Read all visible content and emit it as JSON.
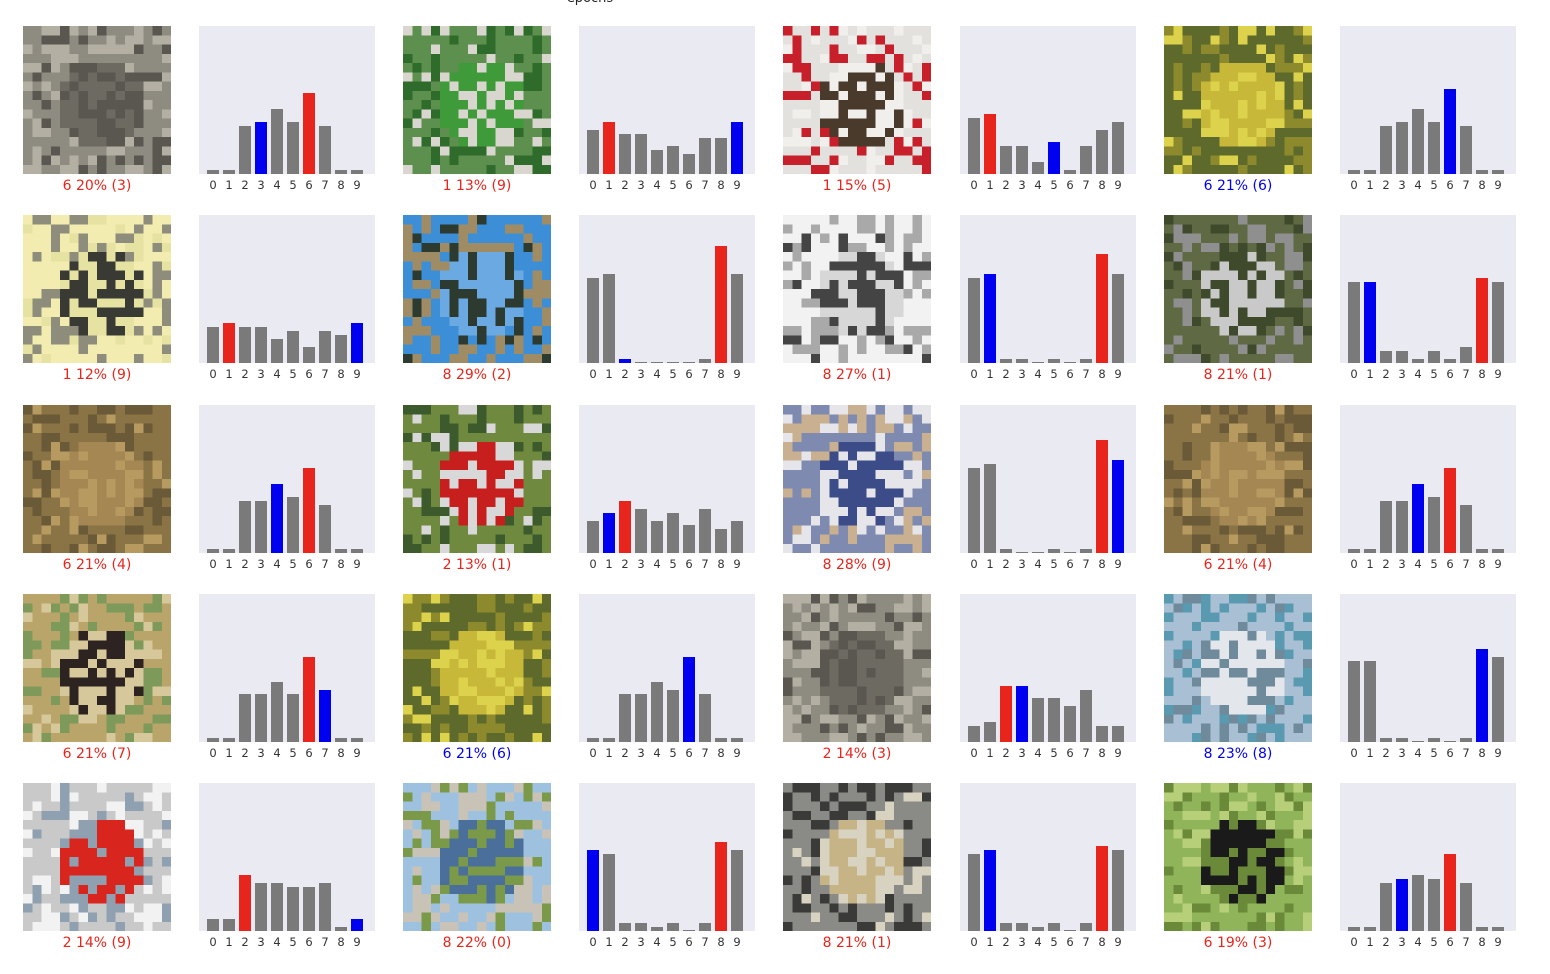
{
  "header_label": "epochs",
  "colors": {
    "predicted_wrong": "#e8251c",
    "true_label": "#0000f0",
    "other": "#7a7a7a",
    "caption_wrong": "#e8251c",
    "caption_right": "#0000f0",
    "bar_bg": "#eaeaf2"
  },
  "tick_labels": [
    "0",
    "1",
    "2",
    "3",
    "4",
    "5",
    "6",
    "7",
    "8",
    "9"
  ],
  "chart_data": {
    "type": "bar",
    "grid": false,
    "ylim": [
      0,
      1
    ],
    "categories": [
      "0",
      "1",
      "2",
      "3",
      "4",
      "5",
      "6",
      "7",
      "8",
      "9"
    ],
    "panels": [
      {
        "image": "cat",
        "caption": "6 20% (3)",
        "predicted": 6,
        "true": 3,
        "values": [
          0.01,
          0.01,
          0.12,
          0.13,
          0.16,
          0.13,
          0.2,
          0.12,
          0.01,
          0.01
        ]
      },
      {
        "image": "green truck",
        "caption": "1 13% (9)",
        "predicted": 1,
        "true": 9,
        "values": [
          0.11,
          0.13,
          0.1,
          0.1,
          0.06,
          0.07,
          0.05,
          0.09,
          0.09,
          0.13
        ]
      },
      {
        "image": "dog with flower",
        "caption": "1 15% (5)",
        "predicted": 1,
        "true": 5,
        "values": [
          0.14,
          0.15,
          0.07,
          0.07,
          0.03,
          0.08,
          0.01,
          0.07,
          0.11,
          0.13
        ]
      },
      {
        "image": "frog",
        "caption": "6 21% (6)",
        "predicted": 6,
        "true": 6,
        "values": [
          0.01,
          0.01,
          0.12,
          0.13,
          0.16,
          0.13,
          0.21,
          0.12,
          0.01,
          0.01
        ]
      },
      {
        "image": "truck side",
        "caption": "1 12% (9)",
        "predicted": 1,
        "true": 9,
        "values": [
          0.09,
          0.1,
          0.09,
          0.09,
          0.06,
          0.08,
          0.04,
          0.08,
          0.07,
          0.1
        ]
      },
      {
        "image": "ostrich",
        "caption": "8 29% (2)",
        "predicted": 8,
        "true": 2,
        "values": [
          0.21,
          0.22,
          0.01,
          0.0,
          0.0,
          0.0,
          0.0,
          0.01,
          0.29,
          0.22
        ]
      },
      {
        "image": "white car",
        "caption": "8 27% (1)",
        "predicted": 8,
        "true": 1,
        "values": [
          0.21,
          0.22,
          0.01,
          0.01,
          0.0,
          0.01,
          0.0,
          0.01,
          0.27,
          0.22
        ]
      },
      {
        "image": "silver car",
        "caption": "8 21% (1)",
        "predicted": 8,
        "true": 1,
        "values": [
          0.2,
          0.2,
          0.03,
          0.03,
          0.01,
          0.03,
          0.01,
          0.04,
          0.21,
          0.2
        ]
      },
      {
        "image": "deer",
        "caption": "6 21% (4)",
        "predicted": 6,
        "true": 4,
        "values": [
          0.01,
          0.01,
          0.13,
          0.13,
          0.17,
          0.14,
          0.21,
          0.12,
          0.01,
          0.01
        ]
      },
      {
        "image": "red car",
        "caption": "2 13% (1)",
        "predicted": 2,
        "true": 1,
        "values": [
          0.08,
          0.1,
          0.13,
          0.11,
          0.08,
          0.1,
          0.07,
          0.11,
          0.06,
          0.08
        ]
      },
      {
        "image": "blue truck",
        "caption": "8 28% (9)",
        "predicted": 8,
        "true": 9,
        "values": [
          0.21,
          0.22,
          0.01,
          0.0,
          0.0,
          0.01,
          0.0,
          0.01,
          0.28,
          0.23
        ]
      },
      {
        "image": "deer",
        "caption": "6 21% (4)",
        "predicted": 6,
        "true": 4,
        "values": [
          0.01,
          0.01,
          0.13,
          0.13,
          0.17,
          0.14,
          0.21,
          0.12,
          0.01,
          0.01
        ]
      },
      {
        "image": "horse",
        "caption": "6 21% (7)",
        "predicted": 6,
        "true": 7,
        "values": [
          0.01,
          0.01,
          0.12,
          0.12,
          0.15,
          0.12,
          0.21,
          0.13,
          0.01,
          0.01
        ]
      },
      {
        "image": "frog",
        "caption": "6 21% (6)",
        "predicted": 6,
        "true": 6,
        "values": [
          0.01,
          0.01,
          0.12,
          0.12,
          0.15,
          0.13,
          0.21,
          0.12,
          0.01,
          0.01
        ]
      },
      {
        "image": "cat",
        "caption": "2 14% (3)",
        "predicted": 2,
        "true": 3,
        "values": [
          0.04,
          0.05,
          0.14,
          0.14,
          0.11,
          0.11,
          0.09,
          0.13,
          0.04,
          0.04
        ]
      },
      {
        "image": "ship",
        "caption": "8 23% (8)",
        "predicted": 8,
        "true": 8,
        "values": [
          0.2,
          0.2,
          0.01,
          0.01,
          0.0,
          0.01,
          0.0,
          0.01,
          0.23,
          0.21
        ]
      },
      {
        "image": "red truck",
        "caption": "2 14% (9)",
        "predicted": 2,
        "true": 9,
        "values": [
          0.03,
          0.03,
          0.14,
          0.12,
          0.12,
          0.11,
          0.11,
          0.12,
          0.01,
          0.03
        ]
      },
      {
        "image": "airplane",
        "caption": "8 22% (0)",
        "predicted": 8,
        "true": 0,
        "values": [
          0.2,
          0.19,
          0.02,
          0.02,
          0.01,
          0.02,
          0.0,
          0.02,
          0.22,
          0.2
        ]
      },
      {
        "image": "old car",
        "caption": "8 21% (1)",
        "predicted": 8,
        "true": 1,
        "values": [
          0.19,
          0.2,
          0.02,
          0.02,
          0.01,
          0.02,
          0.0,
          0.02,
          0.21,
          0.2
        ]
      },
      {
        "image": "black cat",
        "caption": "6 19% (3)",
        "predicted": 6,
        "true": 3,
        "values": [
          0.01,
          0.01,
          0.12,
          0.13,
          0.14,
          0.13,
          0.19,
          0.12,
          0.01,
          0.01
        ]
      }
    ]
  }
}
